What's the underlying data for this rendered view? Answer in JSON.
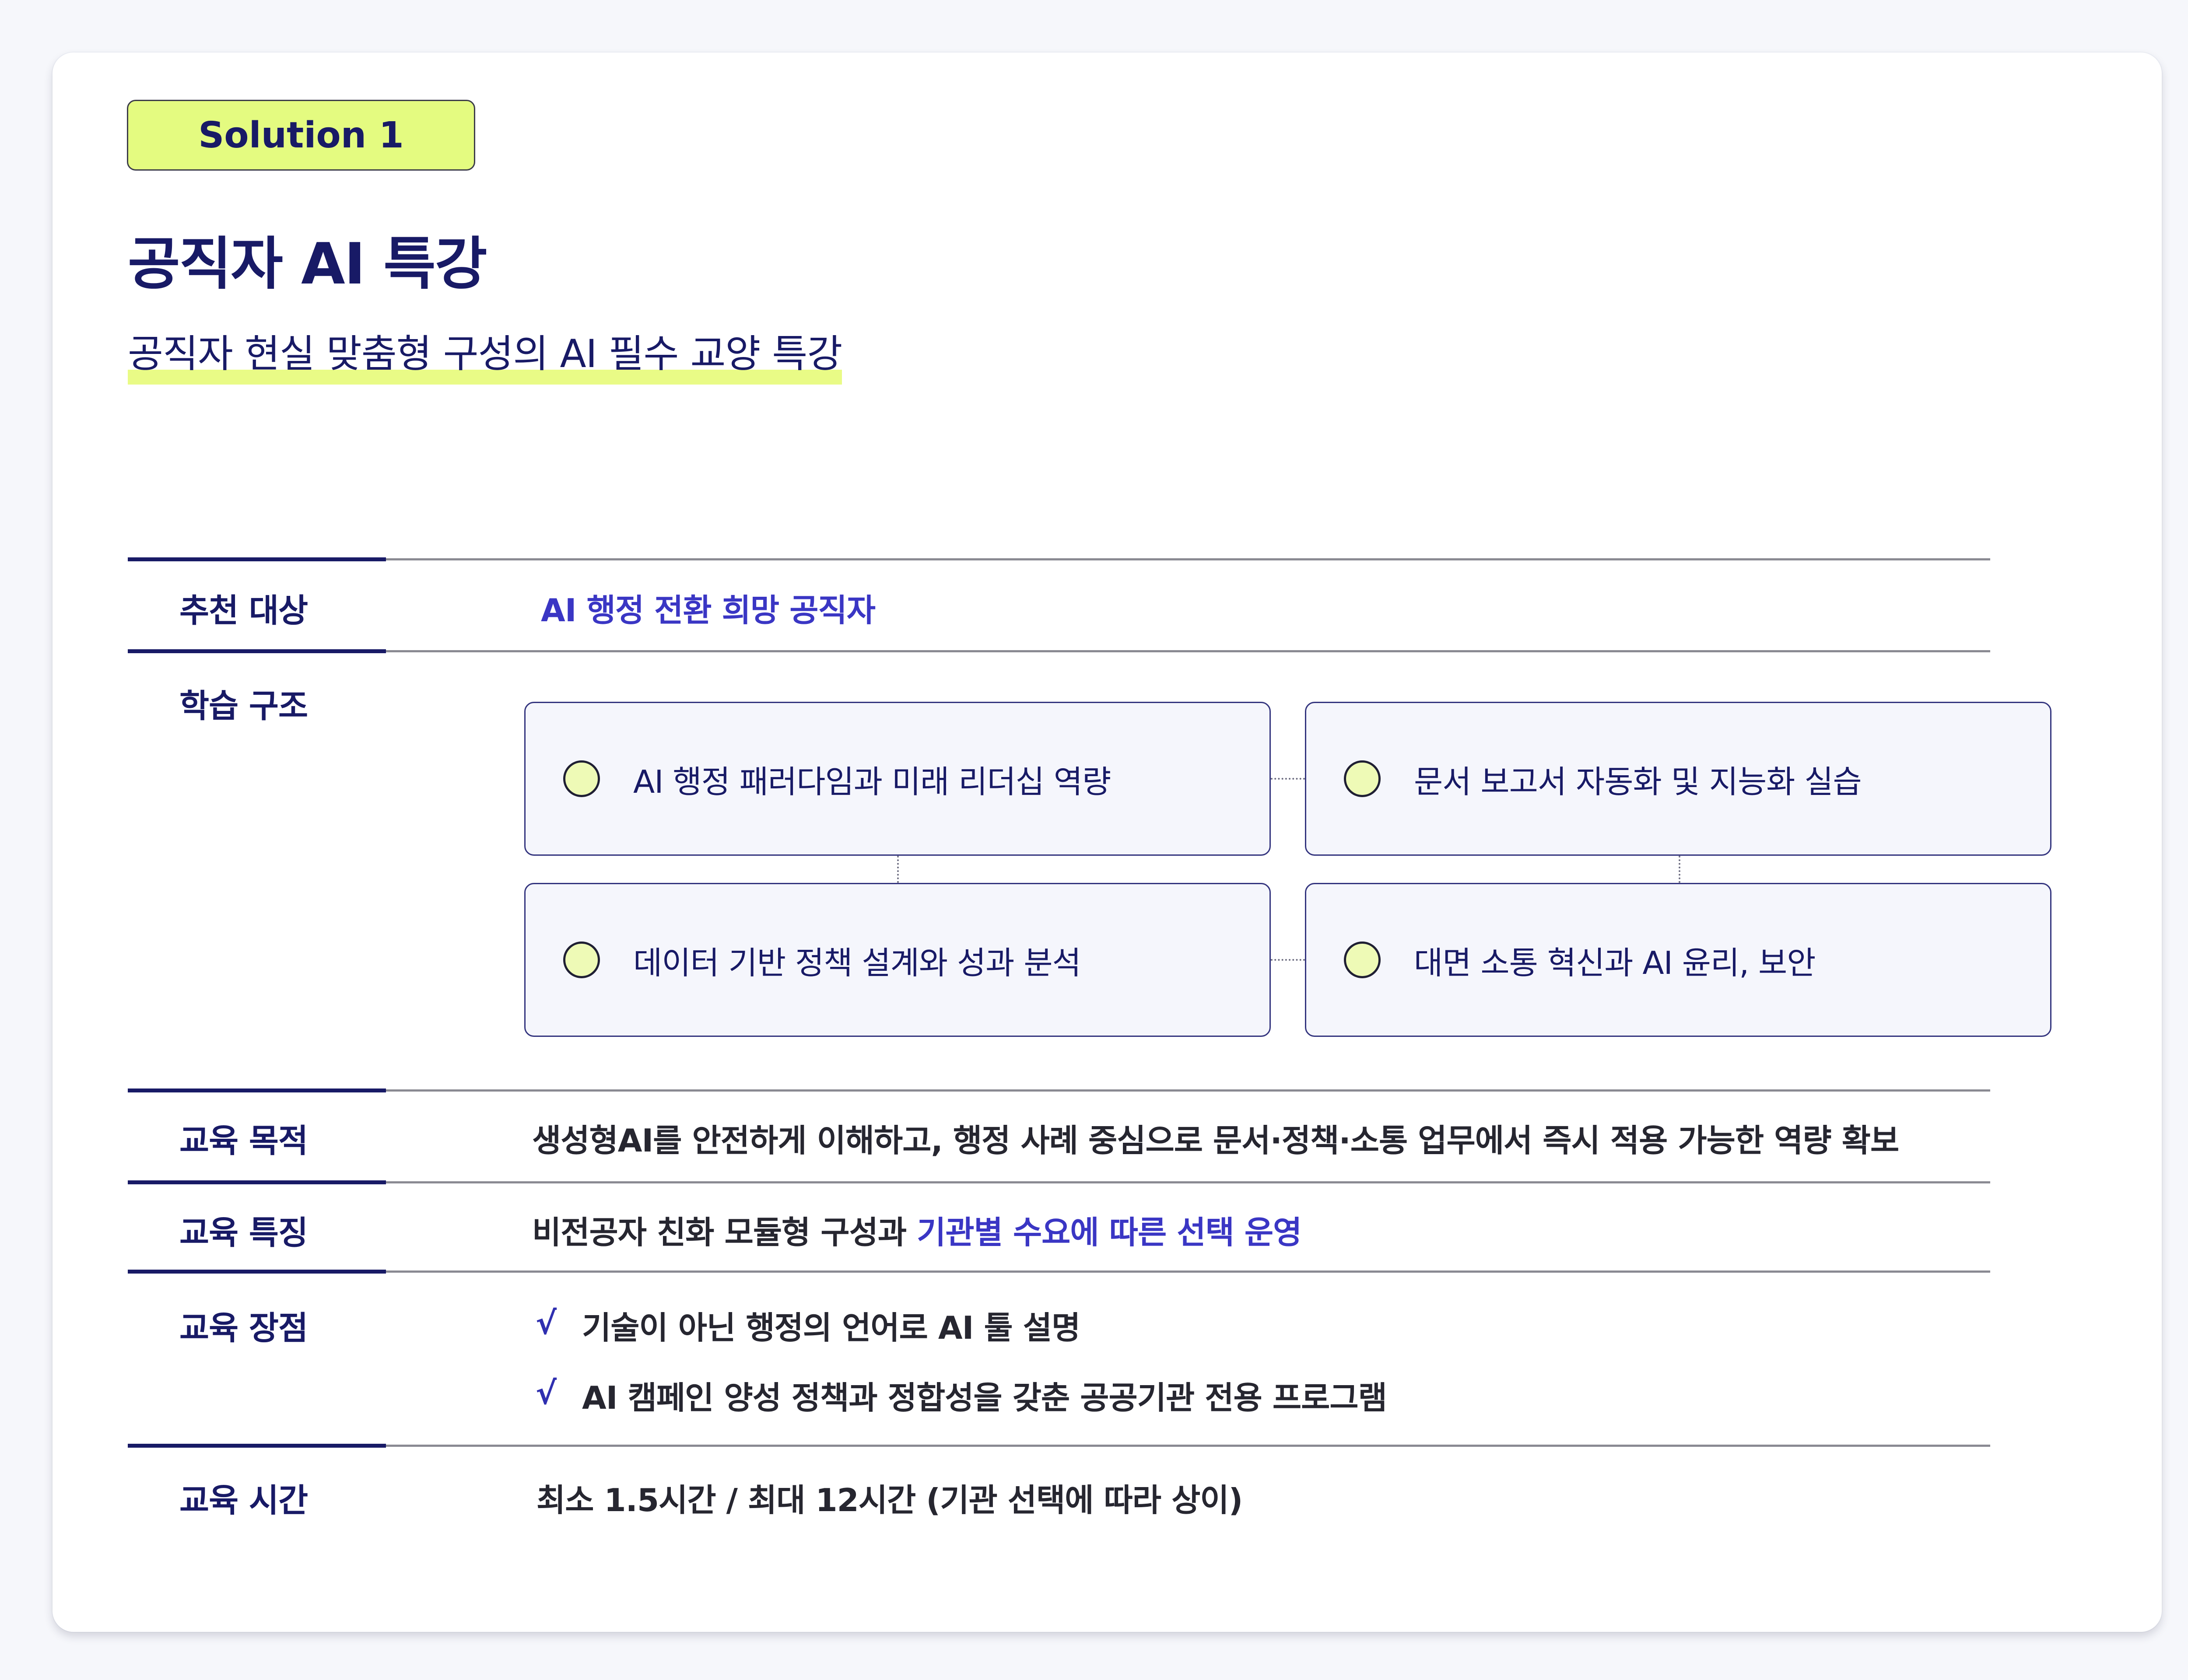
{
  "header": {
    "badge": "Solution 1",
    "title": "공직자 AI 특강",
    "subtitle": "공직자 현실 맞춤형 구성의 AI 필수 교양 특강"
  },
  "rows": {
    "target": {
      "label": "추천 대상",
      "value": "AI 행정 전환 희망 공직자"
    },
    "structure": {
      "label": "학습 구조",
      "modules": [
        "AI 행정 패러다임과 미래 리더십 역량",
        "문서 보고서  자동화 및 지능화 실습",
        "데이터 기반 정책 설계와 성과 분석",
        "대면 소통 혁신과 AI 윤리, 보안"
      ]
    },
    "purpose": {
      "label": "교육 목적",
      "value": "생성형AI를 안전하게 이해하고, 행정 사례 중심으로 문서·정책·소통 업무에서 즉시 적용 가능한 역량 확보"
    },
    "feature": {
      "label": "교육 특징",
      "value_plain": "비전공자 친화 모듈형 구성과 ",
      "value_highlight": "기관별 수요에 따른 선택 운영"
    },
    "advantage": {
      "label": "교육 장점",
      "check_mark": "√",
      "items": [
        "기술이 아닌 행정의 언어로 AI 툴 설명",
        "AI 캠페인 양성 정책과 정합성을 갖춘 공공기관 전용 프로그램"
      ]
    },
    "duration": {
      "label": "교육 시간",
      "value": "최소 1.5시간 / 최대 12시간 (기관 선택에 따라 상이)"
    }
  },
  "colors": {
    "navy": "#181a66",
    "lime": "#e4fb80",
    "highlight_blue": "#3a36c4",
    "box_bg": "#f5f6fc"
  },
  "icons": {
    "module_bullet": "circle-bullet-icon",
    "check": "check-icon"
  }
}
